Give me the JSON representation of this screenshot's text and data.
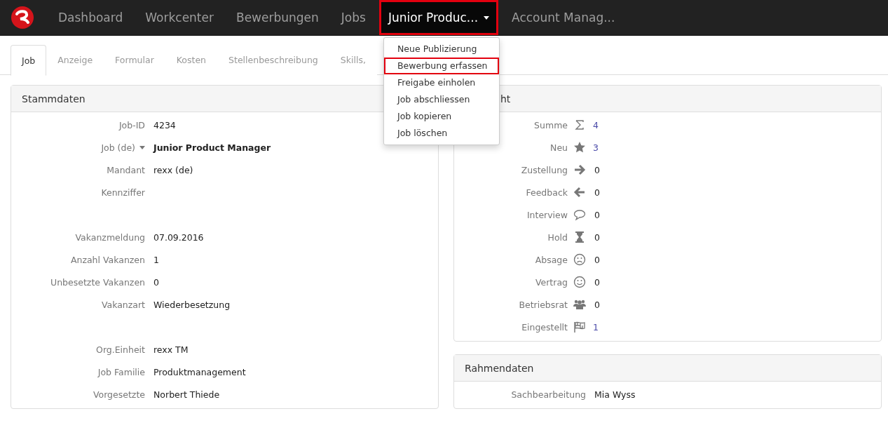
{
  "nav": {
    "items": [
      {
        "label": "Dashboard",
        "selected": false,
        "highlighted": false,
        "dropdown": false
      },
      {
        "label": "Workcenter",
        "selected": false,
        "highlighted": false,
        "dropdown": false
      },
      {
        "label": "Bewerbungen",
        "selected": false,
        "highlighted": false,
        "dropdown": false
      },
      {
        "label": "Jobs",
        "selected": false,
        "highlighted": false,
        "dropdown": false
      },
      {
        "label": "Junior Produc...",
        "selected": true,
        "highlighted": true,
        "dropdown": true
      },
      {
        "label": "Account Manag...",
        "selected": false,
        "highlighted": false,
        "dropdown": false
      }
    ]
  },
  "dropdown_menu": {
    "items": [
      {
        "label": "Neue Publizierung",
        "highlighted": false
      },
      {
        "label": "Bewerbung erfassen",
        "highlighted": true
      },
      {
        "label": "Freigabe einholen",
        "highlighted": false
      },
      {
        "label": "Job abschliessen",
        "highlighted": false
      },
      {
        "label": "Job kopieren",
        "highlighted": false
      },
      {
        "label": "Job löschen",
        "highlighted": false
      }
    ]
  },
  "tabs": [
    {
      "label": "Job",
      "selected": true
    },
    {
      "label": "Anzeige",
      "selected": false
    },
    {
      "label": "Formular",
      "selected": false
    },
    {
      "label": "Kosten",
      "selected": false
    },
    {
      "label": "Stellenbeschreibung",
      "selected": false
    },
    {
      "label": "Skills,",
      "selected": false
    }
  ],
  "stammdaten": {
    "title": "Stammdaten",
    "rows": [
      {
        "label": "Job-ID",
        "value": "4234",
        "kind": "plain",
        "gap_before": false
      },
      {
        "label": "Job (de)",
        "value": "Junior Product Manager",
        "kind": "dropdown",
        "gap_before": false
      },
      {
        "label": "Mandant",
        "value": "rexx (de)",
        "kind": "plain",
        "gap_before": false
      },
      {
        "label": "Kennziffer",
        "kind": "plain",
        "gap_before": false
      },
      {
        "label": "Vakanzmeldung",
        "value": "07.09.2016",
        "kind": "plain",
        "gap_before": true
      },
      {
        "label": "Anzahl Vakanzen",
        "value": "1",
        "kind": "plain",
        "gap_before": false
      },
      {
        "label": "Unbesetzte Vakanzen",
        "value": "0",
        "kind": "plain",
        "gap_before": false
      },
      {
        "label": "Vakanzart",
        "value": "Wiederbesetzung",
        "kind": "plain",
        "gap_before": false
      },
      {
        "label": "Org.Einheit",
        "value": "rexx TM",
        "kind": "plain",
        "gap_before": true
      },
      {
        "label": "Job Familie",
        "value": "Produktmanagement",
        "kind": "plain",
        "gap_before": false
      },
      {
        "label": "Vorgesetzte",
        "value": "Norbert Thiede",
        "kind": "plain",
        "gap_before": false
      }
    ]
  },
  "overview": {
    "title": "ht",
    "rows": [
      {
        "label": "Summe",
        "kind": "sum",
        "value": "4",
        "linked": true
      },
      {
        "label": "Neu",
        "kind": "star",
        "value": "3",
        "linked": true
      },
      {
        "label": "Zustellung",
        "kind": "forward",
        "value": "0",
        "linked": false
      },
      {
        "label": "Feedback",
        "kind": "back",
        "value": "0",
        "linked": false
      },
      {
        "label": "Interview",
        "kind": "chat",
        "value": "0",
        "linked": false
      },
      {
        "label": "Hold",
        "kind": "hourglass",
        "value": "0",
        "linked": false
      },
      {
        "label": "Absage",
        "kind": "frown",
        "value": "0",
        "linked": false
      },
      {
        "label": "Vertrag",
        "kind": "smile",
        "value": "0",
        "linked": false
      },
      {
        "label": "Betriebsrat",
        "kind": "users",
        "value": "0",
        "linked": false
      },
      {
        "label": "Eingestellt",
        "kind": "flag",
        "value": "1",
        "linked": true
      }
    ]
  },
  "rahmendaten": {
    "title": "Rahmendaten",
    "rows": [
      {
        "label": "Sachbearbeitung",
        "value": "Mia Wyss"
      }
    ]
  }
}
